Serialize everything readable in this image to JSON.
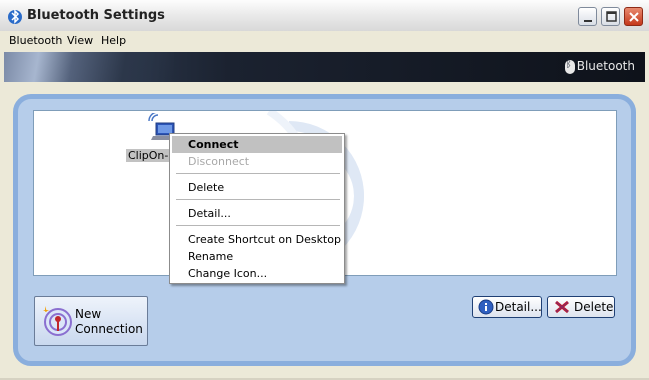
{
  "window": {
    "title": "Bluetooth Settings"
  },
  "menu": [
    "Bluetooth",
    "View",
    "Help"
  ],
  "banner": {
    "logo_text": "Bluetooth"
  },
  "device": {
    "label": "ClipOn-B"
  },
  "context_menu": {
    "items": [
      {
        "label": "Connect",
        "state": "selected"
      },
      {
        "label": "Disconnect",
        "state": "disabled"
      },
      {
        "label": "Delete",
        "state": "normal"
      },
      {
        "label": "Detail...",
        "state": "normal"
      },
      {
        "label": "Create Shortcut on Desktop",
        "state": "normal"
      },
      {
        "label": "Rename",
        "state": "normal"
      },
      {
        "label": "Change Icon...",
        "state": "normal"
      }
    ]
  },
  "buttons": {
    "new_connection_line1": "New",
    "new_connection_line2": "Connection",
    "detail": "Detail...",
    "delete": "Delete"
  },
  "colors": {
    "panel_bg": "#b6cdea",
    "panel_border": "#8aaedd",
    "accent": "#c5381b"
  }
}
